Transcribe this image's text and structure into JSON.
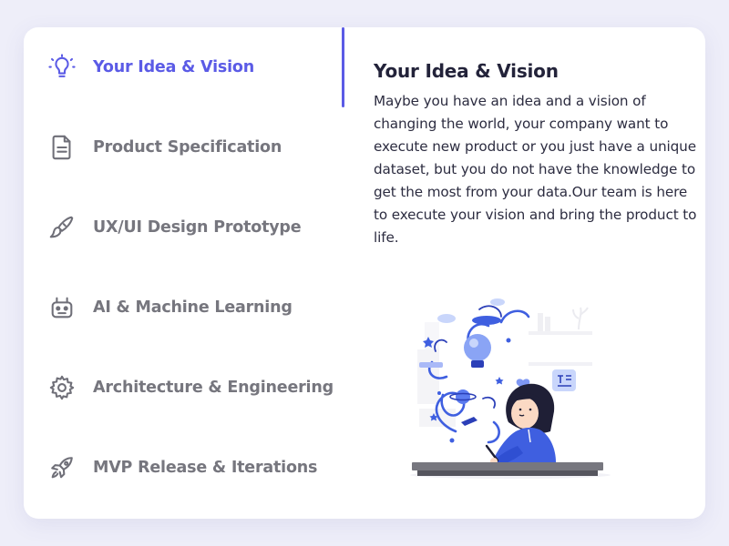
{
  "nav": {
    "items": [
      {
        "label": "Your Idea & Vision",
        "icon": "lightbulb-icon",
        "active": true
      },
      {
        "label": "Product Specification",
        "icon": "document-icon",
        "active": false
      },
      {
        "label": "UX/UI Design Prototype",
        "icon": "brush-icon",
        "active": false
      },
      {
        "label": "AI & Machine Learning",
        "icon": "robot-icon",
        "active": false
      },
      {
        "label": "Architecture & Engineering",
        "icon": "gear-icon",
        "active": false
      },
      {
        "label": "MVP Release & Iterations",
        "icon": "rocket-icon",
        "active": false
      }
    ]
  },
  "content": {
    "title": "Your Idea & Vision",
    "body": "Maybe you have an idea and a vision of changing the world, your company want to execute new product or you just have a unique dataset, but you do not have the knowledge to get the most from your data.Our team is here to execute your vision and bring the product to life."
  },
  "colors": {
    "accent": "#5b5be6",
    "inactive": "#76767e",
    "background": "#eeeef9",
    "card": "#ffffff"
  }
}
